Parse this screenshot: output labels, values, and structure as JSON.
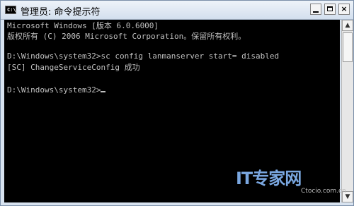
{
  "window": {
    "title": "管理员: 命令提示符",
    "icon": "cmd-app-icon",
    "icon_text": "C:\\",
    "controls": {
      "minimize": "minimize-icon",
      "maximize": "maximize-icon",
      "close": "×"
    }
  },
  "console": {
    "lines": [
      "Microsoft Windows [版本 6.0.6000]",
      "版权所有 (C) 2006 Microsoft Corporation。保留所有权利。",
      "",
      "D:\\Windows\\system32>sc config lanmanserver start= disabled",
      "[SC] ChangeServiceConfig 成功",
      "",
      "D:\\Windows\\system32>"
    ],
    "text_color": "#c0c0c0",
    "background": "#000000"
  },
  "scrollbar": {
    "up_arrow": "▲",
    "down_arrow": "▼"
  },
  "watermark": {
    "logo": "IT专家网",
    "site": "Ctocio.com.cn",
    "color": "#7aa7e0"
  }
}
